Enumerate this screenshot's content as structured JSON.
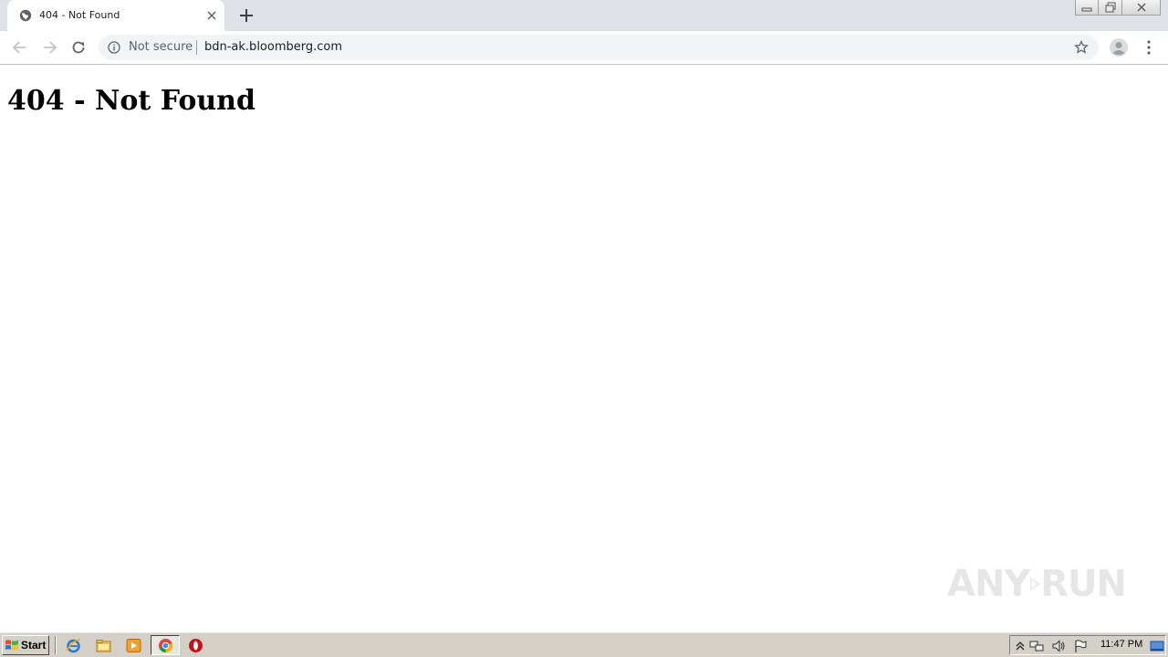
{
  "browser": {
    "tab": {
      "title": "404 - Not Found",
      "favicon": "globe-icon"
    },
    "omnibox": {
      "security_label": "Not secure",
      "url": "bdn-ak.bloomberg.com"
    },
    "icons": {
      "back": "arrow-left-icon",
      "forward": "arrow-right-icon",
      "reload": "reload-icon",
      "bookmark": "star-icon",
      "profile": "account-icon",
      "menu": "vertical-dots-icon"
    }
  },
  "page": {
    "heading": "404 - Not Found"
  },
  "taskbar": {
    "start_label": "Start",
    "clock": "11:47 PM"
  },
  "watermark": {
    "left_text": "ANY",
    "right_text": "RUN"
  },
  "colors": {
    "tabstrip_bg": "#dee1e6",
    "omnibox_bg": "#f1f3f4",
    "taskbar_bg": "#d4d0c8"
  }
}
